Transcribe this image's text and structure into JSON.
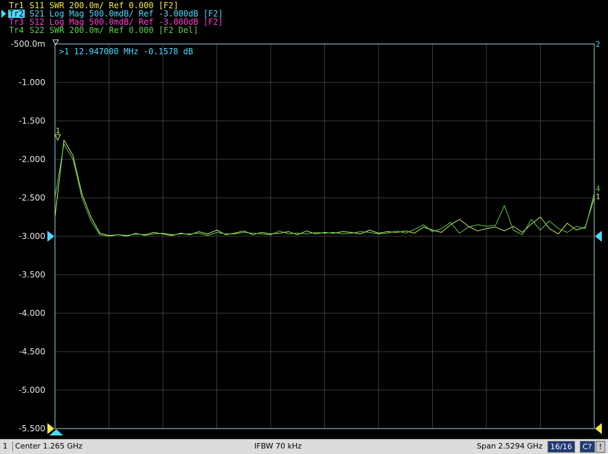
{
  "traces": [
    {
      "name": "Tr1",
      "param": "S11",
      "format": "SWR",
      "scale": "200.0m/",
      "ref": "Ref 0.000",
      "flags": "[F2]",
      "color": "#f2e84a",
      "flag_color": "#f2e84a",
      "active": false
    },
    {
      "name": "Tr2",
      "param": "S21",
      "format": "Log Mag",
      "scale": "500.0mdB/",
      "ref": "Ref -3.000dB",
      "flags": "[F2]",
      "color": "#4fd9ff",
      "flag_color": "#4fd9ff",
      "active": true
    },
    {
      "name": "Tr3",
      "param": "S12",
      "format": "Log Mag",
      "scale": "500.0mdB/",
      "ref": "Ref -3.000dB",
      "flags": "[F2]",
      "color": "#ff3fd0",
      "flag_color": "#ff3fd0",
      "active": false
    },
    {
      "name": "Tr4",
      "param": "S22",
      "format": "SWR",
      "scale": "200.0m/",
      "ref": "Ref 0.000",
      "flags": "[F2 Del]",
      "color": "#5cd04a",
      "flag_color": "#5cd04a",
      "active": false
    }
  ],
  "marker_readout": ">1  12.947000 MHz -0.1578 dB",
  "channel_number": "2",
  "status": {
    "channel": "1",
    "center": "Center 1.265 GHz",
    "ifbw": "IFBW 70 kHz",
    "span": "Span 2.5294 GHz",
    "points": "16/16",
    "cal": "C?",
    "warn": "!"
  },
  "chart_data": {
    "type": "line",
    "ylabel": "",
    "xlabel": "",
    "yticks": [
      "-500.0m",
      "-1.000",
      "-1.500",
      "-2.000",
      "-2.500",
      "-3.000",
      "-3.500",
      "-4.000",
      "-4.500",
      "-5.000",
      "-5.500"
    ],
    "ytick_values": [
      -0.5,
      -1.0,
      -1.5,
      -2.0,
      -2.5,
      -3.0,
      -3.5,
      -4.0,
      -4.5,
      -5.0,
      -5.5
    ],
    "ylim": [
      -5.5,
      -0.5
    ],
    "xlim": [
      0.0002,
      2.5296
    ],
    "x_unit": "GHz",
    "grid": true,
    "reference_level": -3.0,
    "colors": {
      "grid": "#3c3c3c",
      "frame": "#9fd8ea",
      "axis_text": "#e6e6e6",
      "ref_marker": "#4fd9ff",
      "bottom_marker": "#f2e84a",
      "marker": "#c9f06a"
    },
    "marker": {
      "label": "1",
      "x": 0.012947,
      "y": -1.75
    },
    "end_labels": [
      "4",
      "1"
    ],
    "series": [
      {
        "color": "#c9f06a",
        "values": [
          -2.75,
          -1.75,
          -1.95,
          -2.45,
          -2.75,
          -2.96,
          -2.99,
          -2.98,
          -2.99,
          -2.97,
          -2.98,
          -2.95,
          -2.97,
          -2.99,
          -2.96,
          -2.98,
          -2.94,
          -2.97,
          -2.92,
          -2.98,
          -2.96,
          -2.93,
          -2.98,
          -2.95,
          -2.97,
          -2.96,
          -2.94,
          -2.98,
          -2.93,
          -2.97,
          -2.95,
          -2.96,
          -2.94,
          -2.95,
          -2.97,
          -2.92,
          -2.96,
          -2.94,
          -2.95,
          -2.93,
          -2.96,
          -2.88,
          -2.92,
          -2.95,
          -2.85,
          -2.78,
          -2.87,
          -2.93,
          -2.9,
          -2.88,
          -2.93,
          -2.87,
          -2.95,
          -2.84,
          -2.75,
          -2.9,
          -2.97,
          -2.83,
          -2.92,
          -2.88,
          -2.5
        ]
      },
      {
        "color": "#5cd04a",
        "values": [
          -2.5,
          -1.8,
          -2.0,
          -2.5,
          -2.8,
          -2.98,
          -3.0,
          -2.98,
          -3.0,
          -2.96,
          -2.99,
          -2.97,
          -2.96,
          -2.98,
          -2.97,
          -2.97,
          -2.96,
          -2.99,
          -2.95,
          -2.97,
          -2.97,
          -2.95,
          -2.96,
          -2.97,
          -2.98,
          -2.93,
          -2.97,
          -2.96,
          -2.97,
          -2.95,
          -2.96,
          -2.95,
          -2.97,
          -2.96,
          -2.94,
          -2.95,
          -2.97,
          -2.96,
          -2.93,
          -2.96,
          -2.91,
          -2.85,
          -2.94,
          -2.9,
          -2.82,
          -2.96,
          -2.88,
          -2.85,
          -2.87,
          -2.86,
          -2.6,
          -2.92,
          -2.98,
          -2.78,
          -2.92,
          -2.8,
          -2.9,
          -2.95,
          -2.87,
          -2.9,
          -2.44
        ]
      }
    ]
  }
}
